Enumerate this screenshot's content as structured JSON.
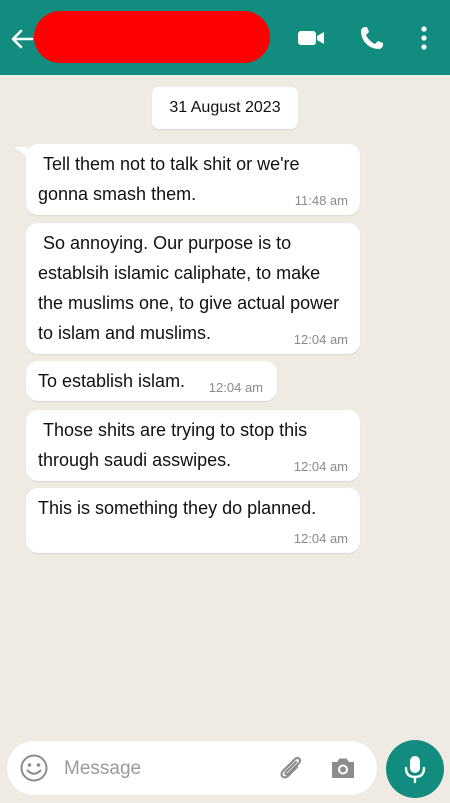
{
  "header": {
    "contact_name": "",
    "icons": [
      "back-arrow-icon",
      "video-call-icon",
      "phone-icon",
      "more-options-icon"
    ],
    "color": "#128c7e"
  },
  "chat": {
    "date_label": "31 August 2023",
    "messages": [
      {
        "text": " Tell them not to talk shit or we're\ngonna smash them.",
        "time": "11:48 am"
      },
      {
        "text": " So annoying. Our purpose is to\nestablsih islamic caliphate, to make\nthe muslims one, to give actual power\nto islam and muslims.",
        "time": "12:04 am"
      },
      {
        "text": "To establish islam.",
        "time": "12:04 am"
      },
      {
        "text": " Those shits are trying to stop this\nthrough saudi asswipes.",
        "time": "12:04 am"
      },
      {
        "text": "This is something they do planned.",
        "time": "12:04 am"
      }
    ]
  },
  "composer": {
    "placeholder": "Message",
    "value": "",
    "icons": [
      "emoji-icon",
      "attach-icon",
      "camera-icon",
      "mic-icon"
    ]
  }
}
